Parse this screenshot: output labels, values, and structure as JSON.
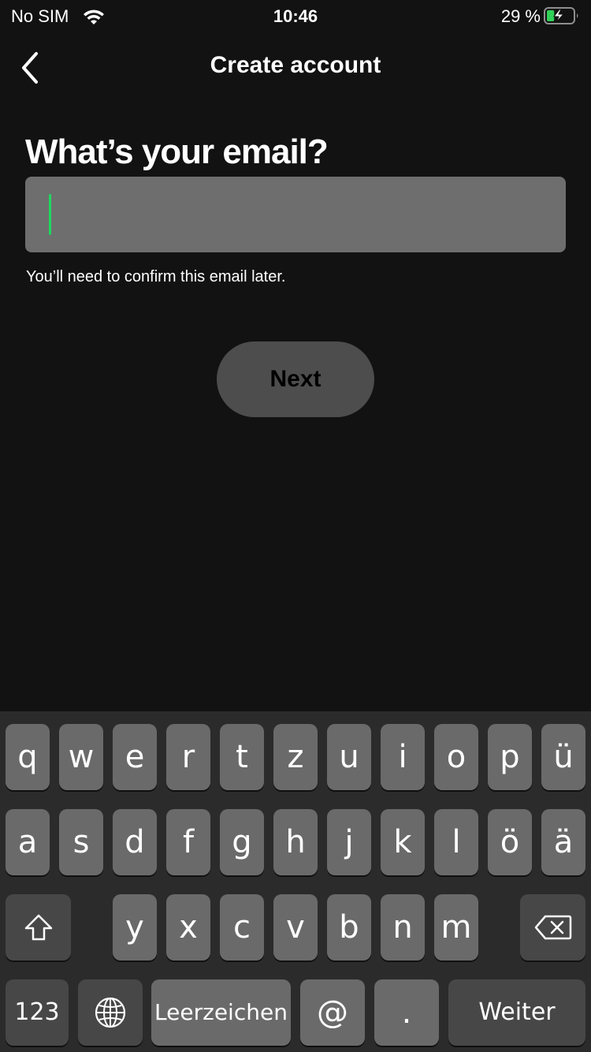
{
  "status_bar": {
    "carrier": "No SIM",
    "time": "10:46",
    "battery_percent": "29 %",
    "battery_level": 0.29,
    "battery_color": "#30d158"
  },
  "nav": {
    "back_icon": "chevron-left-icon",
    "title": "Create account"
  },
  "form": {
    "heading": "What’s your email?",
    "email_value": "",
    "caret_color": "#1ed760",
    "hint": "You’ll need to confirm this email later.",
    "next_label": "Next"
  },
  "keyboard": {
    "row1": [
      "q",
      "w",
      "e",
      "r",
      "t",
      "z",
      "u",
      "i",
      "o",
      "p",
      "ü"
    ],
    "row2": [
      "a",
      "s",
      "d",
      "f",
      "g",
      "h",
      "j",
      "k",
      "l",
      "ö",
      "ä"
    ],
    "row3": [
      "y",
      "x",
      "c",
      "v",
      "b",
      "n",
      "m"
    ],
    "shift_icon": "shift-icon",
    "delete_icon": "backspace-icon",
    "numbers_label": "123",
    "globe_icon": "globe-icon",
    "space_label": "Leerzeichen",
    "at_label": "@",
    "dot_label": ".",
    "return_label": "Weiter"
  }
}
